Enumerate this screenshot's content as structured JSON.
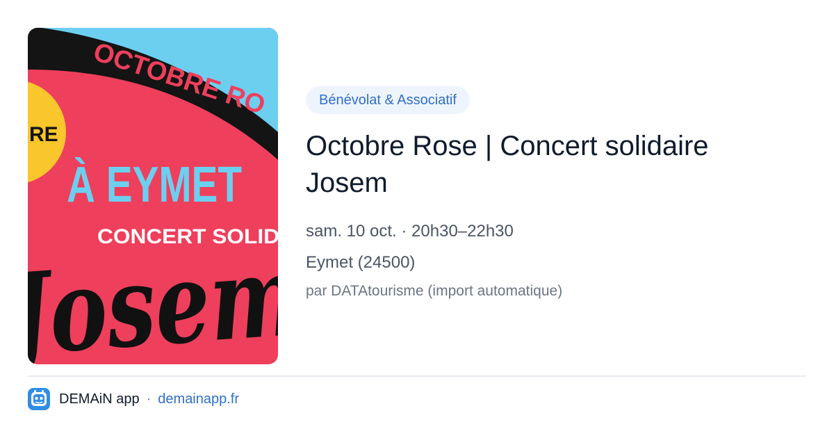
{
  "event": {
    "category": "Bénévolat & Associatif",
    "title": "Octobre Rose | Concert solidaire Josem",
    "datetime": "sam. 10 oct. · 20h30–22h30",
    "location": "Eymet (24500)",
    "source": "par DATAtourisme (import automatique)"
  },
  "poster": {
    "banner_text": "OCTOBRE RO",
    "badge_text": "RE",
    "city_text": "À EYMET",
    "concert_text": "CONCERT SOLID",
    "artist_text": "Josem",
    "colors": {
      "sky": "#6dcff0",
      "band": "#141414",
      "background": "#ee3f5c",
      "badge": "#f9c62c",
      "banner_text": "#ee3f5c",
      "city_text": "#6dcff0",
      "concert_text": "#ffffff",
      "artist_text": "#111111"
    }
  },
  "footer": {
    "app_name": "DEMAiN app",
    "separator": "·",
    "url": "demainapp.fr",
    "icon": "demain-app-icon"
  },
  "theme": {
    "accent": "#2f6fc9",
    "chip_background": "#eef4fb",
    "text_primary": "#0f1b2d",
    "text_secondary": "#4a5566"
  }
}
